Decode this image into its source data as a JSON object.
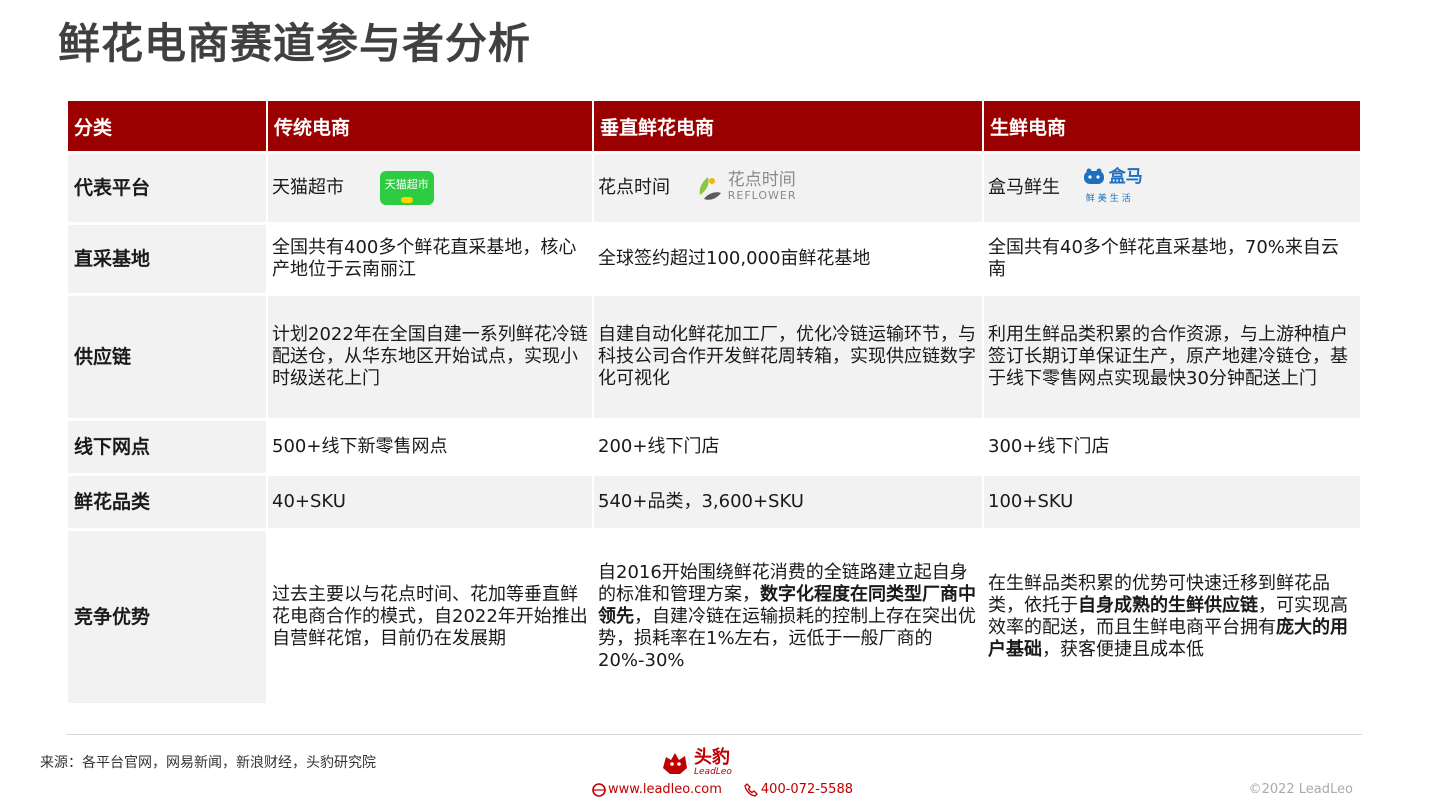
{
  "page_title": "鲜花电商赛道参与者分析",
  "table": {
    "header": [
      "分类",
      "传统电商",
      "垂直鲜花电商",
      "生鲜电商"
    ],
    "rows": [
      {
        "label": "代表平台",
        "cells": [
          "天猫超市",
          "花点时间",
          "盒马鲜生"
        ],
        "logos": [
          {
            "text": "天猫超市",
            "icon": "tmall-logo-icon"
          },
          {
            "text": "花点时间",
            "sub": "REFLOWER",
            "icon": "reflower-logo-icon"
          },
          {
            "text": "盒马",
            "sub": "鲜美生活",
            "icon": "hema-logo-icon"
          }
        ]
      },
      {
        "label": "直采基地",
        "cells": [
          "全国共有400多个鲜花直采基地，核心产地位于云南丽江",
          "全球签约超过100,000亩鲜花基地",
          "全国共有40多个鲜花直采基地，70%来自云南"
        ]
      },
      {
        "label": "供应链",
        "cells": [
          "计划2022年在全国自建一系列鲜花冷链配送仓，从华东地区开始试点，实现小时级送花上门",
          "自建自动化鲜花加工厂，优化冷链运输环节，与科技公司合作开发鲜花周转箱，实现供应链数字化可视化",
          "利用生鲜品类积累的合作资源，与上游种植户签订长期订单保证生产，原产地建冷链仓，基于线下零售网点实现最快30分钟配送上门"
        ]
      },
      {
        "label": "线下网点",
        "cells": [
          "500+线下新零售网点",
          "200+线下门店",
          "300+线下门店"
        ]
      },
      {
        "label": "鲜花品类",
        "cells": [
          "40+SKU",
          "540+品类，3,600+SKU",
          "100+SKU"
        ]
      },
      {
        "label": "竞争优势",
        "cells": [
          {
            "parts": [
              "过去主要以与花点时间、花加等垂直鲜花电商合作的模式，自2022年开始推出自营鲜花馆，目前仍在发展期"
            ]
          },
          {
            "parts": [
              "自2016开始围绕鲜花消费的全链路建立起自身的标准和管理方案，",
              "数字化程度在同类型厂商中领先",
              "，自建冷链在运输损耗的控制上存在突出优势，损耗率在1%左右，远低于一般厂商的20%-30%"
            ]
          },
          {
            "parts": [
              "在生鲜品类积累的优势可快速迁移到鲜花品类，依托于",
              "自身成熟的生鲜供应链",
              "，可实现高效率的配送，而且生鲜电商平台拥有",
              "庞大的用户基础",
              "，获客便捷且成本低"
            ]
          }
        ]
      }
    ]
  },
  "footer": {
    "source": "来源：各平台官网，网易新闻，新浪财经，头豹研究院",
    "brand_cn": "头豹",
    "brand_en": "LeadLeo",
    "website": "www.leadleo.com",
    "phone": "400-072-5588",
    "copyright": "©2022 LeadLeo"
  },
  "colors": {
    "header_bg": "#9b0000",
    "accent_red": "#c00000",
    "row_shade": "#f2f2f2",
    "tmall_green": "#2ecc40",
    "hema_blue": "#1e6fbf"
  }
}
